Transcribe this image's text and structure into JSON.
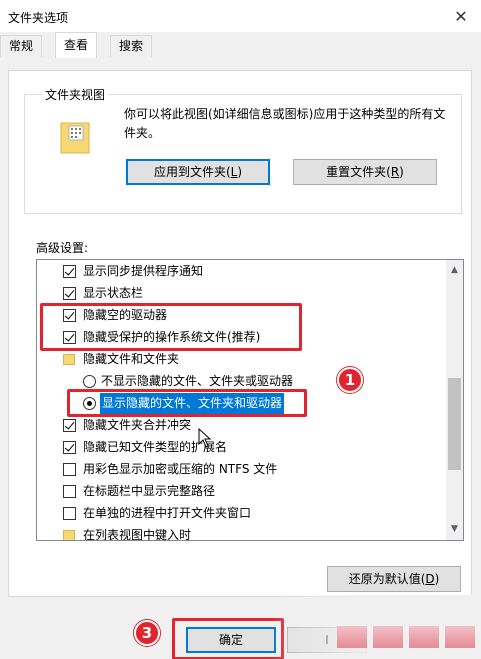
{
  "window": {
    "title": "文件夹选项",
    "close_glyph": "✕"
  },
  "tabs": [
    {
      "label": "常规"
    },
    {
      "label": "查看"
    },
    {
      "label": "搜索"
    }
  ],
  "folder_views": {
    "legend": "文件夹视图",
    "description": "你可以将此视图(如详细信息或图标)应用于这种类型的所有文件夹。",
    "apply_button": {
      "label": "应用到文件夹(",
      "key": "L",
      "suffix": ")"
    },
    "reset_button": {
      "label": "重置文件夹(",
      "key": "R",
      "suffix": ")"
    }
  },
  "advanced": {
    "label": "高级设置:",
    "items": [
      {
        "type": "checkbox",
        "checked": true,
        "label": "显示同步提供程序通知"
      },
      {
        "type": "checkbox",
        "checked": true,
        "label": "显示状态栏"
      },
      {
        "type": "checkbox",
        "checked": true,
        "label": "隐藏空的驱动器"
      },
      {
        "type": "checkbox",
        "checked": true,
        "label": "隐藏受保护的操作系统文件(推荐)"
      },
      {
        "type": "folder",
        "label": "隐藏文件和文件夹"
      },
      {
        "type": "radio",
        "checked": false,
        "label": "不显示隐藏的文件、文件夹或驱动器"
      },
      {
        "type": "radio",
        "checked": true,
        "label": "显示隐藏的文件、文件夹和驱动器"
      },
      {
        "type": "checkbox",
        "checked": true,
        "label": "隐藏文件夹合并冲突"
      },
      {
        "type": "checkbox",
        "checked": true,
        "label": "隐藏已知文件类型的扩展名"
      },
      {
        "type": "checkbox",
        "checked": false,
        "label": "用彩色显示加密或压缩的 NTFS 文件"
      },
      {
        "type": "checkbox",
        "checked": false,
        "label": "在标题栏中显示完整路径"
      },
      {
        "type": "checkbox",
        "checked": false,
        "label": "在单独的进程中打开文件夹窗口"
      },
      {
        "type": "folder",
        "label": "在列表视图中键入时"
      }
    ]
  },
  "restore_button": {
    "label": "还原为默认值(",
    "key": "D",
    "suffix": ")"
  },
  "ok_button": {
    "label": "确定"
  },
  "cancel_button": {
    "label": "I"
  },
  "annotations": {
    "badge_1": "1",
    "badge_3": "3",
    "highlight_color": "#e0252e"
  },
  "colors": {
    "selection": "#0078d7",
    "folder": "#f8d775"
  }
}
